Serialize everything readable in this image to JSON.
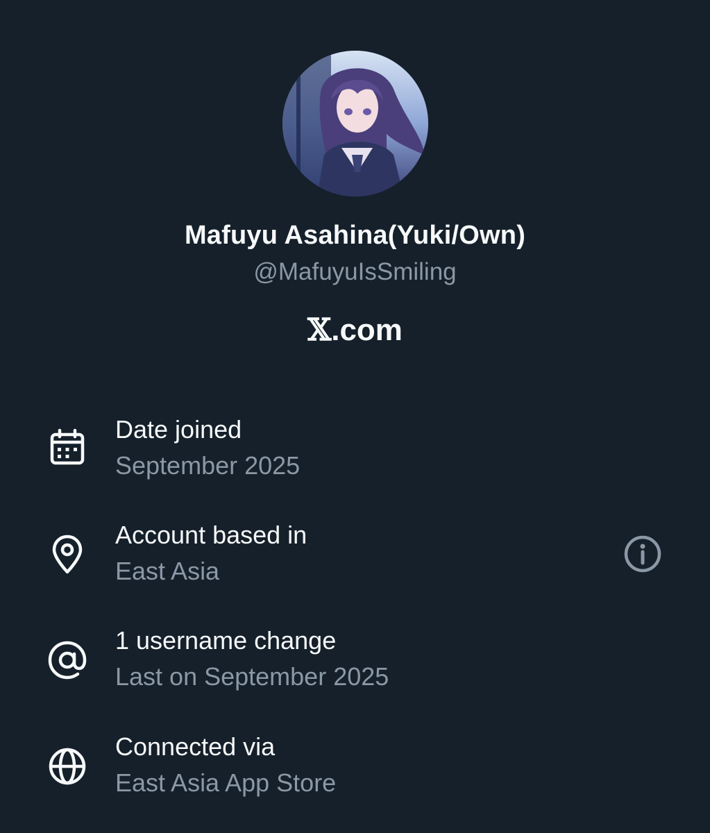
{
  "profile": {
    "display_name": "Mafuyu Asahina(Yuki/Own)",
    "handle": "@MafuyuIsSmiling",
    "avatar_icon": "profile-avatar"
  },
  "brand": {
    "glyph": "𝕏",
    "suffix": ".com"
  },
  "about_rows": [
    {
      "icon": "calendar-icon",
      "label": "Date joined",
      "value": "September 2025"
    },
    {
      "icon": "location-pin-icon",
      "label": "Account based in",
      "value": "East Asia",
      "trailing_icon": "info-icon"
    },
    {
      "icon": "at-sign-icon",
      "label": "1 username change",
      "value": "Last on September 2025"
    },
    {
      "icon": "globe-icon",
      "label": "Connected via",
      "value": "East Asia App Store"
    }
  ],
  "colors": {
    "background": "#15202b",
    "primary_text": "#f7f9f9",
    "secondary_text": "#8b98a5"
  }
}
